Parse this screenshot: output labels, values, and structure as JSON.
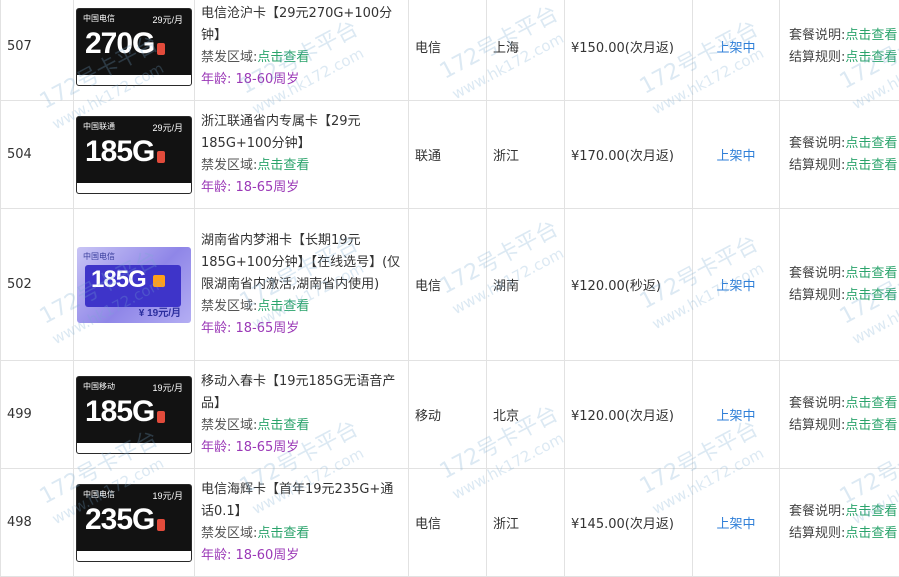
{
  "rows": [
    {
      "id": "507",
      "title": "电信沧沪卡【29元270G+100分钟】",
      "region_label": "禁发区域:",
      "region_link": "点击查看",
      "age": "年龄: 18-60周岁",
      "operator": "电信",
      "region": "上海",
      "price": "¥150.00(次月返)",
      "status": "上架中",
      "card": {
        "style": "dark",
        "brand": "中国电信",
        "gb": "270G",
        "price": "29元/月"
      }
    },
    {
      "id": "504",
      "title": "浙江联通省内专属卡【29元185G+100分钟】",
      "region_label": "禁发区域:",
      "region_link": "点击查看",
      "age": "年龄: 18-65周岁",
      "operator": "联通",
      "region": "浙江",
      "price": "¥170.00(次月返)",
      "status": "上架中",
      "card": {
        "style": "dark",
        "brand": "中国联通",
        "gb": "185G",
        "price": "29元/月"
      }
    },
    {
      "id": "502",
      "title": "湖南省内梦湘卡【长期19元185G+100分钟】【在线选号】(仅限湖南省内激活,湖南省内使用)",
      "region_label": "禁发区域:",
      "region_link": "点击查看",
      "age": "年龄: 18-65周岁",
      "operator": "电信",
      "region": "湖南",
      "price": "¥120.00(秒返)",
      "status": "上架中",
      "card": {
        "style": "light",
        "brand": "中国电信",
        "gb": "185G",
        "price": "¥ 19元/月"
      }
    },
    {
      "id": "499",
      "title": "移动入春卡【19元185G无语音产品】",
      "region_label": "禁发区域:",
      "region_link": "点击查看",
      "age": "年龄: 18-65周岁",
      "operator": "移动",
      "region": "北京",
      "price": "¥120.00(次月返)",
      "status": "上架中",
      "card": {
        "style": "dark",
        "brand": "中国移动",
        "gb": "185G",
        "price": "19元/月"
      }
    },
    {
      "id": "498",
      "title": "电信海辉卡【首年19元235G+通话0.1】",
      "region_label": "禁发区域:",
      "region_link": "点击查看",
      "age": "年龄: 18-60周岁",
      "operator": "电信",
      "region": "浙江",
      "price": "¥145.00(次月返)",
      "status": "上架中",
      "card": {
        "style": "dark",
        "brand": "中国电信",
        "gb": "235G",
        "price": "19元/月"
      }
    }
  ],
  "links": {
    "plan_label": "套餐说明:",
    "plan_link": "点击查看",
    "rule_label": "结算规则:",
    "rule_link": "点击查看"
  },
  "watermark": {
    "line1": "172号卡平台",
    "line2": "www.hk172.com"
  },
  "colors": {
    "link": "#2aa36b",
    "status": "#2f7fd8",
    "age": "#9b39b7",
    "border": "#e2e2e2"
  }
}
